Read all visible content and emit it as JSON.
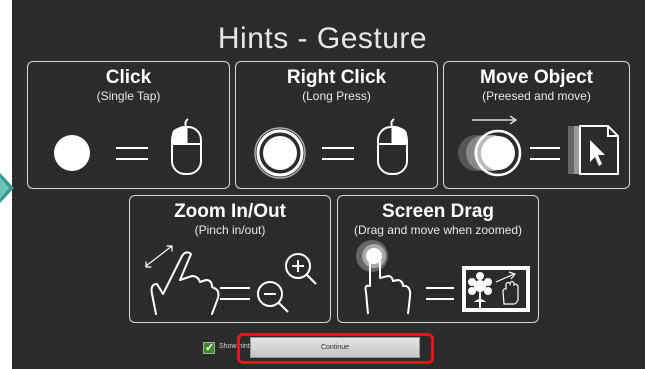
{
  "title": "Hints - Gesture",
  "cards": [
    {
      "title": "Click",
      "subtitle": "(Single Tap)"
    },
    {
      "title": "Right Click",
      "subtitle": "(Long Press)"
    },
    {
      "title": "Move Object",
      "subtitle": "(Preesed and move)"
    },
    {
      "title": "Zoom In/Out",
      "subtitle": "(Pinch in/out)"
    },
    {
      "title": "Screen Drag",
      "subtitle": "(Drag and move when zoomed)"
    }
  ],
  "footer": {
    "show_hints_label": "Show hints",
    "show_hints_checked": true,
    "continue_label": "Continue"
  },
  "colors": {
    "background": "#2b2b2b",
    "highlight": "#e8141c",
    "checkbox": "#3a8a2a",
    "side_arrow": "#3a9a8f"
  },
  "icons": [
    "side-arrow-icon",
    "tap-circle-icon",
    "equals-icon",
    "mouse-left-button-icon",
    "long-press-circle-icon",
    "mouse-right-button-icon",
    "moving-circle-icon",
    "document-cursor-icon",
    "pinch-hand-icon",
    "zoom-in-icon",
    "zoom-out-icon",
    "drag-finger-icon",
    "picture-drag-icon",
    "checkmark-icon"
  ]
}
